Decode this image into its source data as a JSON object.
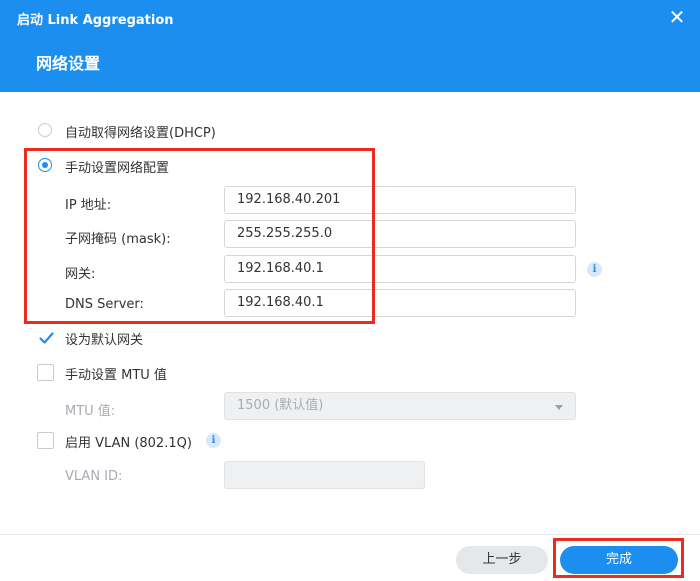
{
  "window": {
    "title": "启动 Link Aggregation",
    "close_glyph": "✕"
  },
  "page": {
    "title": "网络设置"
  },
  "options": {
    "dhcp_label": "自动取得网络设置(DHCP)",
    "manual_label": "手动设置网络配置",
    "selected": "manual"
  },
  "fields": {
    "ip": {
      "label": "IP 地址:",
      "value": "192.168.40.201"
    },
    "mask": {
      "label": "子网掩码 (mask):",
      "value": "255.255.255.0"
    },
    "gateway": {
      "label": "网关:",
      "value": "192.168.40.1"
    },
    "dns": {
      "label": "DNS Server:",
      "value": "192.168.40.1"
    }
  },
  "default_gateway": {
    "label": "设为默认网关",
    "checked": true
  },
  "mtu": {
    "checkbox_label": "手动设置 MTU 值",
    "checked": false,
    "field_label": "MTU 值:",
    "selected_value": "1500 (默认值)"
  },
  "vlan": {
    "checkbox_label": "启用 VLAN (802.1Q)",
    "checked": false,
    "field_label": "VLAN ID:",
    "value": ""
  },
  "info_glyph": "i",
  "buttons": {
    "previous": "上一步",
    "finish": "完成"
  },
  "colors": {
    "accent": "#1b8ef0",
    "highlight": "#ea2b1f"
  }
}
